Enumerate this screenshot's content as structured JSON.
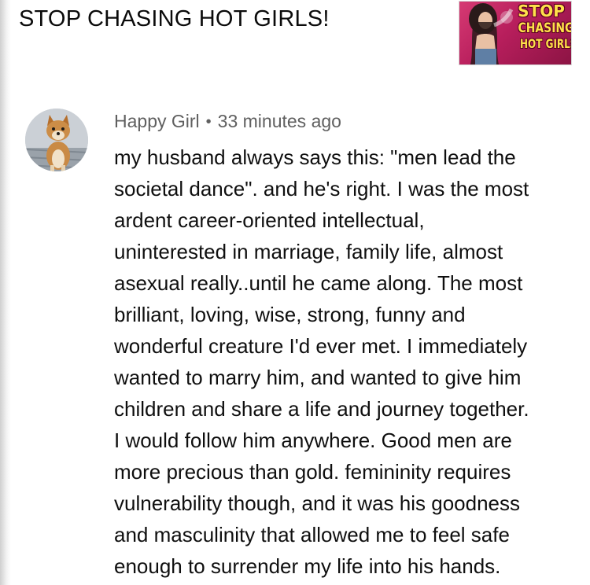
{
  "video": {
    "title": "STOP CHASING HOT GIRLS!",
    "thumbnail": {
      "lines": [
        "STOP",
        "CHASING",
        "HOT GIRLS!"
      ],
      "text_color": "#ffe14a",
      "background_color": "#c42a66"
    }
  },
  "comment": {
    "author": "Happy Girl",
    "separator": "•",
    "time": "33 minutes ago",
    "avatar_icon": "dog-avatar",
    "lines": [
      "my husband always says this: \"men lead the",
      "societal dance\". and he's right. I was the most",
      "ardent career-oriented intellectual,",
      "uninterested in marriage, family life, almost",
      "asexual really..until he came along. The most",
      "brilliant, loving, wise, strong, funny and",
      "wonderful creature I'd ever met. I immediately",
      "wanted to marry him, and wanted to give him",
      "children and share a life and journey together.",
      "I would follow him anywhere. Good men are",
      "more precious than gold. femininity requires",
      "vulnerability though, and it was his goodness",
      "and masculinity that allowed me to feel safe",
      "enough to surrender my life into his hands."
    ]
  }
}
